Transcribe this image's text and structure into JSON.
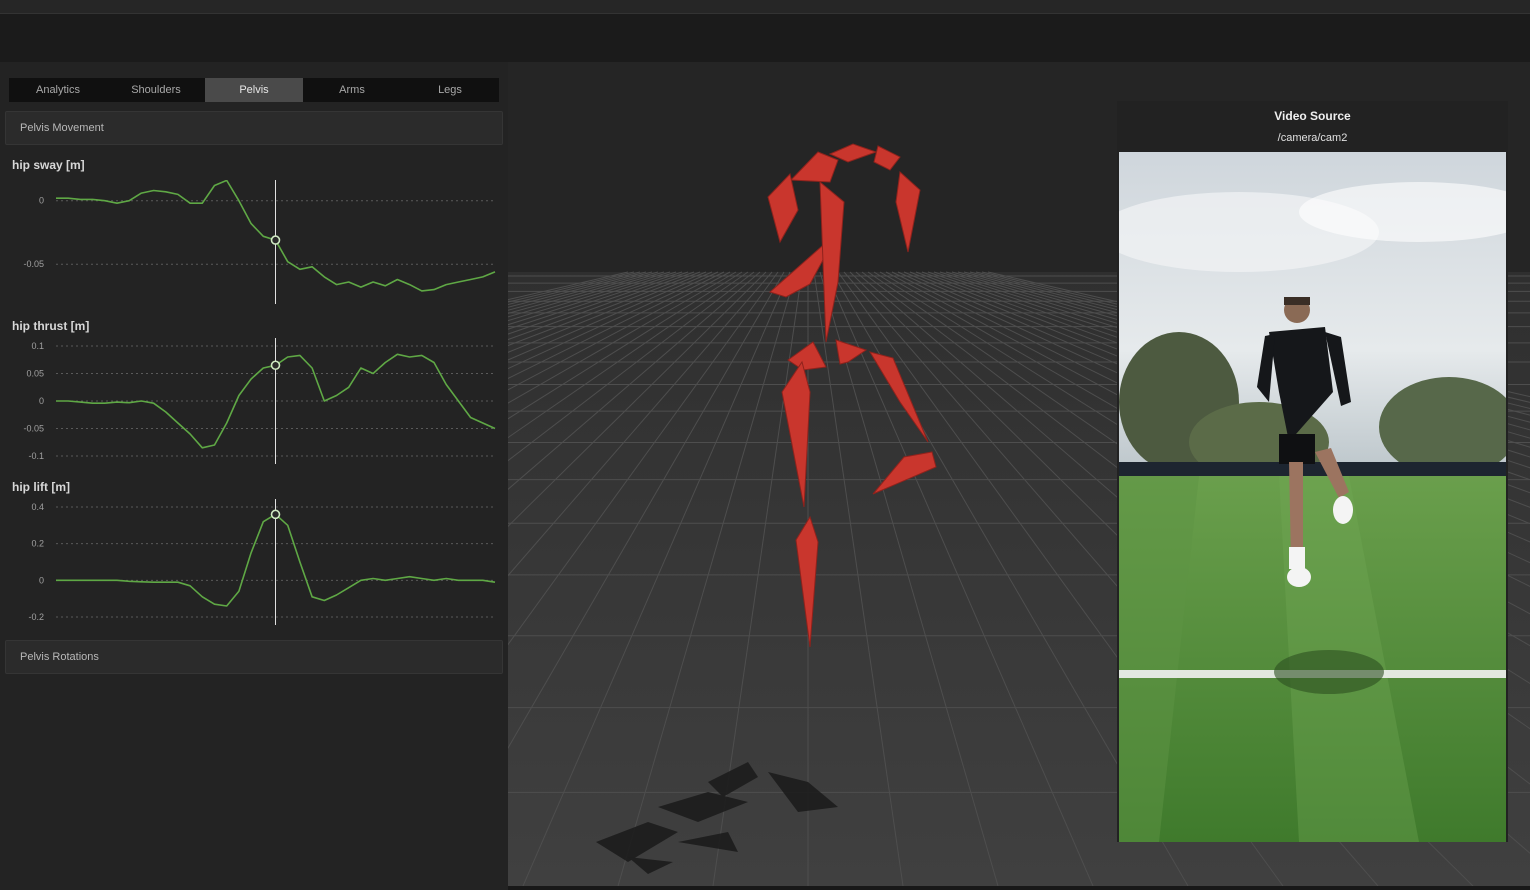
{
  "tabs": [
    {
      "label": "Analytics",
      "active": false
    },
    {
      "label": "Shoulders",
      "active": false
    },
    {
      "label": "Pelvis",
      "active": true
    },
    {
      "label": "Arms",
      "active": false
    },
    {
      "label": "Legs",
      "active": false
    }
  ],
  "sections": {
    "pelvis_movement": "Pelvis Movement",
    "pelvis_rotations": "Pelvis Rotations"
  },
  "plots": {
    "hip_sway": {
      "title": "hip sway [m]",
      "ticks": [
        "0",
        "-0.05"
      ]
    },
    "hip_thrust": {
      "title": "hip thrust [m]",
      "ticks": [
        "0.1",
        "0.05",
        "0",
        "-0.05",
        "-0.1"
      ]
    },
    "hip_lift": {
      "title": "hip lift [m]",
      "ticks": [
        "0.4",
        "0.2",
        "0",
        "-0.2"
      ]
    }
  },
  "colors": {
    "line": "#5fa845",
    "skeleton": "#d23c33",
    "cursor": "#e0e0e0"
  },
  "video": {
    "title": "Video Source",
    "source": "/camera/cam2"
  },
  "chart_data": [
    {
      "type": "line",
      "title": "hip sway [m]",
      "ylim": [
        -0.075,
        0.01
      ],
      "yticks": [
        0,
        -0.05
      ],
      "grid": true,
      "cursor_index": 18,
      "x": [
        0,
        1,
        2,
        3,
        4,
        5,
        6,
        7,
        8,
        9,
        10,
        11,
        12,
        13,
        14,
        15,
        16,
        17,
        18,
        19,
        20,
        21,
        22,
        23,
        24,
        25,
        26,
        27,
        28,
        29,
        30,
        31,
        32,
        33,
        34,
        35,
        36
      ],
      "values": [
        0.002,
        0.002,
        0.001,
        0.001,
        0.0,
        -0.002,
        0.0,
        0.006,
        0.008,
        0.007,
        0.005,
        -0.002,
        -0.002,
        0.012,
        0.016,
        0.0,
        -0.018,
        -0.028,
        -0.031,
        -0.048,
        -0.054,
        -0.052,
        -0.06,
        -0.066,
        -0.064,
        -0.068,
        -0.064,
        -0.067,
        -0.062,
        -0.066,
        -0.071,
        -0.07,
        -0.066,
        -0.064,
        -0.062,
        -0.06,
        -0.056
      ]
    },
    {
      "type": "line",
      "title": "hip thrust [m]",
      "ylim": [
        -0.1,
        0.1
      ],
      "yticks": [
        0.1,
        0.05,
        0,
        -0.05,
        -0.1
      ],
      "grid": true,
      "cursor_index": 18,
      "x": [
        0,
        1,
        2,
        3,
        4,
        5,
        6,
        7,
        8,
        9,
        10,
        11,
        12,
        13,
        14,
        15,
        16,
        17,
        18,
        19,
        20,
        21,
        22,
        23,
        24,
        25,
        26,
        27,
        28,
        29,
        30,
        31,
        32,
        33,
        34,
        35,
        36
      ],
      "values": [
        0.0,
        0.0,
        -0.002,
        -0.004,
        -0.004,
        -0.002,
        -0.003,
        0.0,
        -0.004,
        -0.02,
        -0.04,
        -0.06,
        -0.085,
        -0.08,
        -0.04,
        0.01,
        0.04,
        0.06,
        0.065,
        0.08,
        0.083,
        0.06,
        0.0,
        0.01,
        0.025,
        0.06,
        0.05,
        0.07,
        0.085,
        0.08,
        0.083,
        0.07,
        0.03,
        0.0,
        -0.03,
        -0.04,
        -0.05
      ]
    },
    {
      "type": "line",
      "title": "hip lift [m]",
      "ylim": [
        -0.2,
        0.4
      ],
      "yticks": [
        0.4,
        0.2,
        0,
        -0.2
      ],
      "grid": true,
      "cursor_index": 18,
      "x": [
        0,
        1,
        2,
        3,
        4,
        5,
        6,
        7,
        8,
        9,
        10,
        11,
        12,
        13,
        14,
        15,
        16,
        17,
        18,
        19,
        20,
        21,
        22,
        23,
        24,
        25,
        26,
        27,
        28,
        29,
        30,
        31,
        32,
        33,
        34,
        35,
        36
      ],
      "values": [
        0.0,
        0.0,
        0.0,
        0.0,
        0.0,
        0.0,
        -0.005,
        -0.008,
        -0.01,
        -0.01,
        -0.01,
        -0.03,
        -0.09,
        -0.13,
        -0.14,
        -0.06,
        0.15,
        0.32,
        0.36,
        0.3,
        0.1,
        -0.09,
        -0.11,
        -0.08,
        -0.04,
        0.0,
        0.01,
        0.0,
        0.01,
        0.02,
        0.01,
        0.0,
        0.01,
        0.0,
        0.0,
        0.0,
        -0.01
      ]
    }
  ]
}
